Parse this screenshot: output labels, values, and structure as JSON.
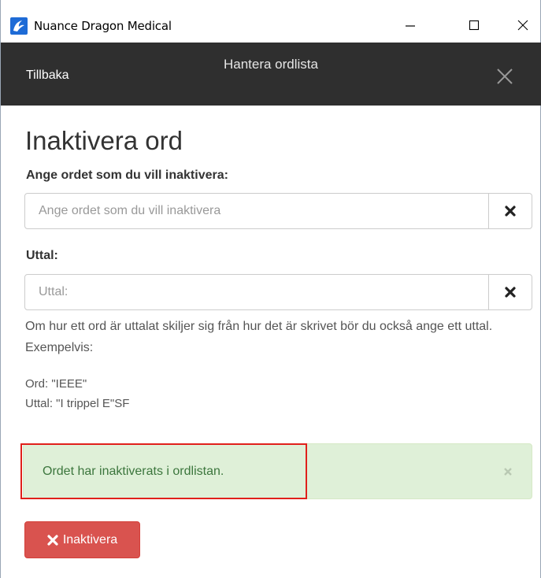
{
  "window": {
    "app_title": "Nuance Dragon Medical",
    "app_icon": "dragon-logo-icon",
    "controls": [
      "minimize-icon",
      "maximize-icon",
      "close-icon"
    ]
  },
  "header": {
    "back_label": "Tillbaka",
    "title": "Hantera ordlista",
    "close_icon": "close-icon"
  },
  "main": {
    "title": "Inaktivera ord",
    "word_field": {
      "label": "Ange ordet som du vill inaktivera:",
      "placeholder": "Ange ordet som du vill inaktivera",
      "value": ""
    },
    "pronunciation_field": {
      "label": "Uttal:",
      "placeholder": "Uttal:",
      "value": ""
    },
    "help_text": "Om hur ett ord är uttalat skiljer sig från hur det är skrivet bör du också ange ett uttal. Exempelvis:",
    "example_word": "Ord: \"IEEE\"",
    "example_pronunciation": "Uttal: \"I trippel E\"SF"
  },
  "alert": {
    "text": "Ordet har inaktiverats i ordlistan.",
    "close_glyph": "×",
    "color_bg": "#dff0d8",
    "color_text": "#3c763d"
  },
  "submit": {
    "label": "Inaktivera",
    "icon": "times-icon",
    "color": "#d9534f"
  },
  "colors": {
    "header_bg": "#2f2f2f",
    "highlight_border": "#e0201b"
  }
}
